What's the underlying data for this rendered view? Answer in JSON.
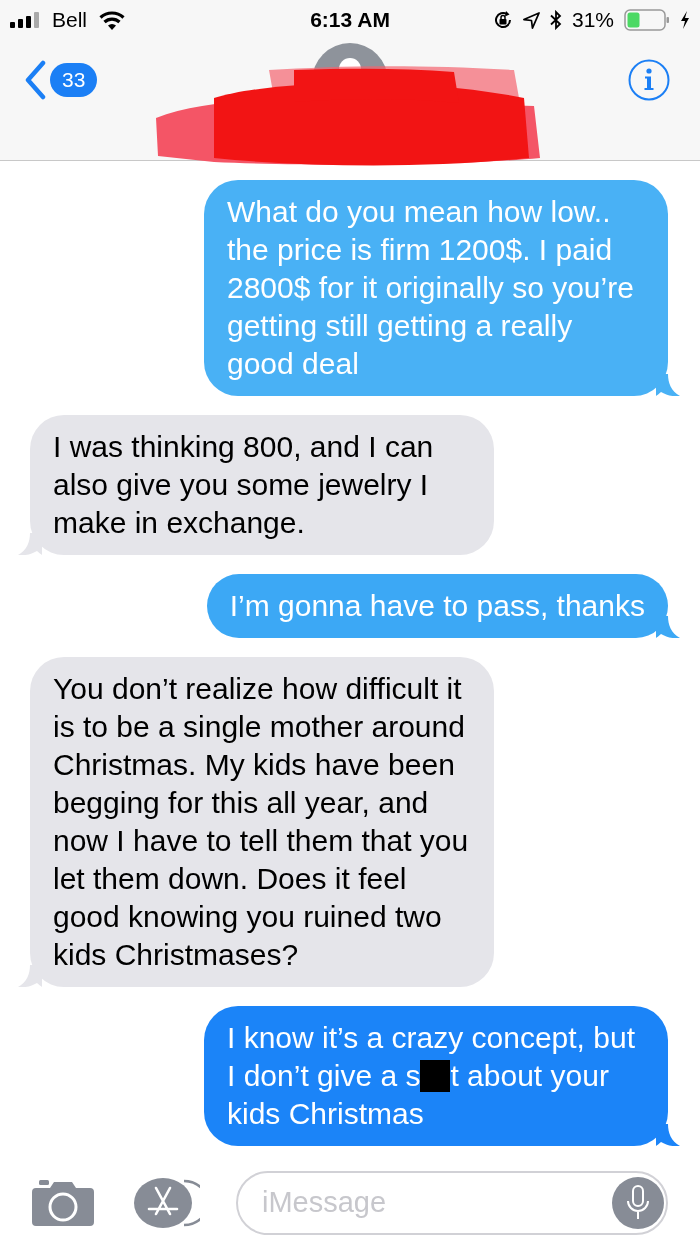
{
  "status_bar": {
    "carrier": "Bell",
    "time": "6:13 AM",
    "battery": "31%"
  },
  "header": {
    "back_badge": "33"
  },
  "messages": [
    {
      "kind": "outgoing",
      "color": "#49b1f5",
      "parts": [
        {
          "kind": "text",
          "text": "What do you mean how low.. the price is firm 1200$. I paid 2800$ for it originally so you’re getting still getting a really good deal"
        }
      ]
    },
    {
      "kind": "incoming",
      "color": "#e5e5ea",
      "parts": [
        {
          "kind": "text",
          "text": "I was thinking 800, and I can also give you some jewelry I make in exchange."
        }
      ]
    },
    {
      "kind": "outgoing",
      "color": "#3ca8f5",
      "parts": [
        {
          "kind": "text",
          "text": "I’m gonna have to pass, thanks"
        }
      ]
    },
    {
      "kind": "incoming",
      "color": "#e5e5ea",
      "parts": [
        {
          "kind": "text",
          "text": "You don’t realize how difficult it is to be a single mother around Christmas. My kids have been begging for this all year, and now I have to tell them that you let them down. Does it feel good knowing you ruined two kids Christmases?"
        }
      ]
    },
    {
      "kind": "outgoing",
      "color": "#1b84f8",
      "parts": [
        {
          "kind": "text",
          "text": "I know it’s a crazy concept, but I don’t give a s"
        },
        {
          "kind": "redaction"
        },
        {
          "kind": "text",
          "text": "t about your kids Christmas"
        }
      ]
    }
  ],
  "composer": {
    "placeholder": "iMessage"
  }
}
